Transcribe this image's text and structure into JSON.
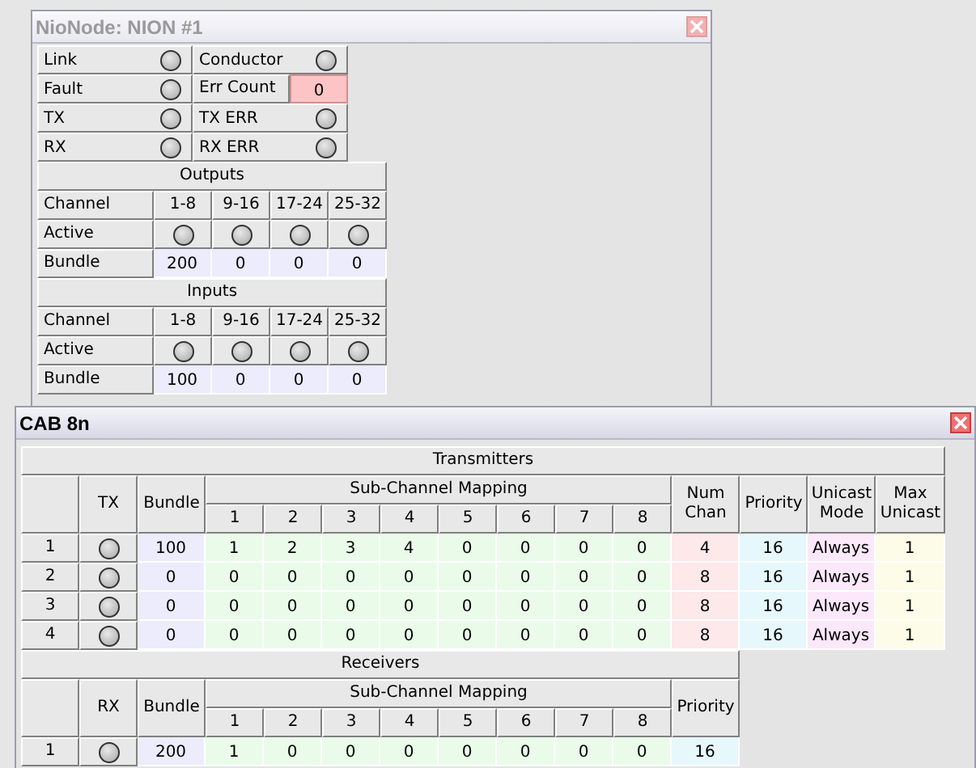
{
  "nionode_window": {
    "title": "NioNode: NION #1",
    "active": false,
    "status": [
      {
        "kind": "led",
        "label": "Link",
        "on": false
      },
      {
        "kind": "led",
        "label": "Conductor",
        "on": false
      },
      {
        "kind": "led",
        "label": "Fault",
        "on": false
      },
      {
        "kind": "value",
        "label": "Err Count",
        "value": "0"
      },
      {
        "kind": "led",
        "label": "TX",
        "on": false
      },
      {
        "kind": "led",
        "label": "TX ERR",
        "on": false
      },
      {
        "kind": "led",
        "label": "RX",
        "on": false
      },
      {
        "kind": "led",
        "label": "RX ERR",
        "on": false
      }
    ],
    "sections": [
      {
        "title": "Outputs",
        "channel_label": "Channel",
        "channels": [
          "1-8",
          "9-16",
          "17-24",
          "25-32"
        ],
        "active_label": "Active",
        "active": [
          {
            "on": false
          },
          {
            "on": false
          },
          {
            "on": false
          },
          {
            "on": false
          }
        ],
        "bundle_label": "Bundle",
        "bundles": [
          "200",
          "0",
          "0",
          "0"
        ]
      },
      {
        "title": "Inputs",
        "channel_label": "Channel",
        "channels": [
          "1-8",
          "9-16",
          "17-24",
          "25-32"
        ],
        "active_label": "Active",
        "active": [
          {
            "on": false
          },
          {
            "on": false
          },
          {
            "on": false
          },
          {
            "on": false
          }
        ],
        "bundle_label": "Bundle",
        "bundles": [
          "100",
          "0",
          "0",
          "0"
        ]
      }
    ]
  },
  "cab_window": {
    "title": "CAB 8n",
    "active": true,
    "transmitters": {
      "title": "Transmitters",
      "columns": {
        "state": "TX",
        "bundle": "Bundle",
        "mapping": "Sub-Channel Mapping",
        "mapping_numbers": [
          "1",
          "2",
          "3",
          "4",
          "5",
          "6",
          "7",
          "8"
        ],
        "num_chan": "Num Chan",
        "priority": "Priority",
        "unicast_mode": "Unicast Mode",
        "max_unicast": "Max Unicast"
      },
      "rows": [
        {
          "index": "1",
          "on": false,
          "bundle": "100",
          "mapping": [
            "1",
            "2",
            "3",
            "4",
            "0",
            "0",
            "0",
            "0"
          ],
          "num_chan": "4",
          "priority": "16",
          "unicast_mode": "Always",
          "max_unicast": "1"
        },
        {
          "index": "2",
          "on": false,
          "bundle": "0",
          "mapping": [
            "0",
            "0",
            "0",
            "0",
            "0",
            "0",
            "0",
            "0"
          ],
          "num_chan": "8",
          "priority": "16",
          "unicast_mode": "Always",
          "max_unicast": "1"
        },
        {
          "index": "3",
          "on": false,
          "bundle": "0",
          "mapping": [
            "0",
            "0",
            "0",
            "0",
            "0",
            "0",
            "0",
            "0"
          ],
          "num_chan": "8",
          "priority": "16",
          "unicast_mode": "Always",
          "max_unicast": "1"
        },
        {
          "index": "4",
          "on": false,
          "bundle": "0",
          "mapping": [
            "0",
            "0",
            "0",
            "0",
            "0",
            "0",
            "0",
            "0"
          ],
          "num_chan": "8",
          "priority": "16",
          "unicast_mode": "Always",
          "max_unicast": "1"
        }
      ]
    },
    "receivers": {
      "title": "Receivers",
      "columns": {
        "state": "RX",
        "bundle": "Bundle",
        "mapping": "Sub-Channel Mapping",
        "mapping_numbers": [
          "1",
          "2",
          "3",
          "4",
          "5",
          "6",
          "7",
          "8"
        ],
        "priority": "Priority"
      },
      "rows": [
        {
          "index": "1",
          "on": false,
          "bundle": "200",
          "mapping": [
            "1",
            "0",
            "0",
            "0",
            "0",
            "0",
            "0",
            "0"
          ],
          "priority": "16"
        }
      ]
    }
  }
}
